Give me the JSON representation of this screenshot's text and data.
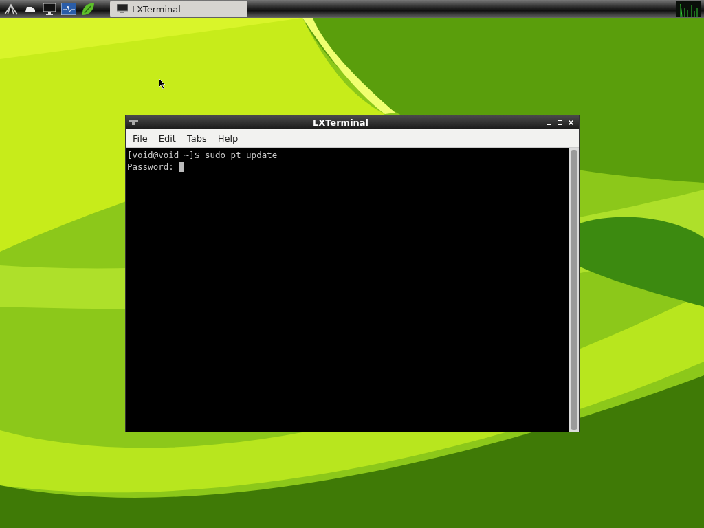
{
  "taskbar": {
    "launchers": [
      {
        "kind": "menu"
      },
      {
        "kind": "files"
      },
      {
        "kind": "desktop"
      },
      {
        "kind": "monitor"
      },
      {
        "kind": "leaf"
      }
    ],
    "tasks": [
      {
        "label": "LXTerminal",
        "selected": true
      }
    ]
  },
  "window": {
    "title": "LXTerminal",
    "menu": [
      "File",
      "Edit",
      "Tabs",
      "Help"
    ],
    "lines": [
      "[void@void ~]$ sudo pt update",
      "Password: "
    ]
  }
}
